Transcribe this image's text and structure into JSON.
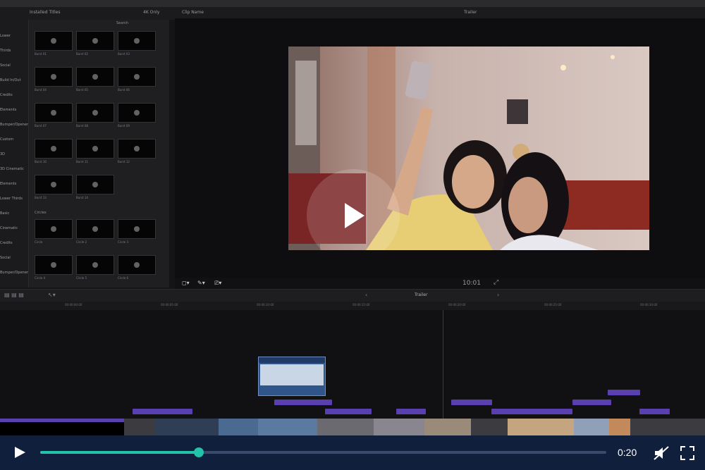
{
  "browser": {
    "header_title": "Installed Titles",
    "show_only_label": "4K Only",
    "search_label": "Search",
    "sidebar_items": [
      "Lower",
      "Thirds",
      "Social",
      "Build In/Out",
      "Credits",
      "Elements",
      "Bumper/Opener",
      "Custom",
      "3D",
      "3D Cinematic",
      "Elements",
      "Lower Thirds",
      "Basic",
      "Cinematic",
      "Credits",
      "Social",
      "Bumper/Opener"
    ],
    "thumbs": [
      "Burst 01",
      "Burst 02",
      "Burst 03",
      "Burst 04",
      "Burst 05",
      "Burst 06",
      "Burst 07",
      "Burst 08",
      "Burst 09",
      "Burst 10",
      "Burst 11",
      "Burst 12",
      "Burst 13",
      "Burst 14"
    ],
    "section2": "Circles",
    "thumbs2": [
      "Circle",
      "Circle 2",
      "Circle 3",
      "Circle 4",
      "Circle 5",
      "Circle 6"
    ]
  },
  "viewer": {
    "project_label": "Clip Name",
    "trailer_label": "Trailer",
    "timecode": "10:01"
  },
  "timeline": {
    "project_name": "Trailer",
    "ticks": [
      "00:00:00:00",
      "00:00:05:00",
      "00:00:10:00",
      "00:00:15:00",
      "00:00:20:00",
      "00:00:25:00",
      "00:00:30:00"
    ]
  },
  "player": {
    "time": "0:20",
    "progress": 0.28
  }
}
